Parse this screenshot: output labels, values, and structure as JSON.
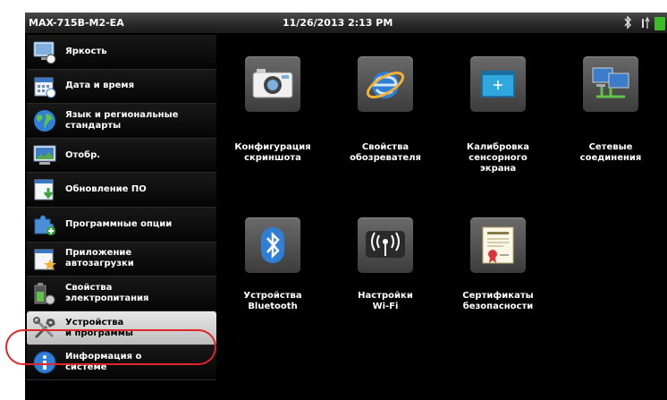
{
  "statusbar": {
    "device_name": "MAX-715B-M2-EA",
    "datetime": "11/26/2013 2:13 PM"
  },
  "sidebar": {
    "items": [
      {
        "label": "Яркость",
        "icon": "monitor-brightness-icon"
      },
      {
        "label": "Дата и время",
        "icon": "calendar-icon"
      },
      {
        "label": "Язык и региональные\nстандарты",
        "icon": "globe-icon"
      },
      {
        "label": "Отобр.",
        "icon": "display-icon"
      },
      {
        "label": "Обновление ПО",
        "icon": "software-update-icon"
      },
      {
        "label": "Программные опции",
        "icon": "puzzle-icon"
      },
      {
        "label": "Приложение\nавтозагрузки",
        "icon": "startup-app-icon"
      },
      {
        "label": "Свойства\nэлектропитания",
        "icon": "battery-icon"
      },
      {
        "label": "Устройства\nи программы",
        "icon": "tools-icon",
        "selected": true
      },
      {
        "label": "Информация о\nсистеме",
        "icon": "info-icon"
      }
    ]
  },
  "tiles": [
    {
      "label": "Конфигурация\nскриншота",
      "icon": "camera-icon"
    },
    {
      "label": "Свойства\nобозревателя",
      "icon": "internet-explorer-icon"
    },
    {
      "label": "Калибровка\nсенсорного\nэкрана",
      "icon": "touch-calibration-icon"
    },
    {
      "label": "Сетевые\nсоединения",
      "icon": "network-connections-icon"
    },
    {
      "label": "Устройства\nBluetooth",
      "icon": "bluetooth-icon"
    },
    {
      "label": "Настройки\nWi-Fi",
      "icon": "wifi-icon"
    },
    {
      "label": "Сертификаты\nбезопасности",
      "icon": "certificate-icon"
    }
  ],
  "colors": {
    "callout": "#e0262b",
    "battery": "#3dbb2a",
    "background": "#000000"
  }
}
